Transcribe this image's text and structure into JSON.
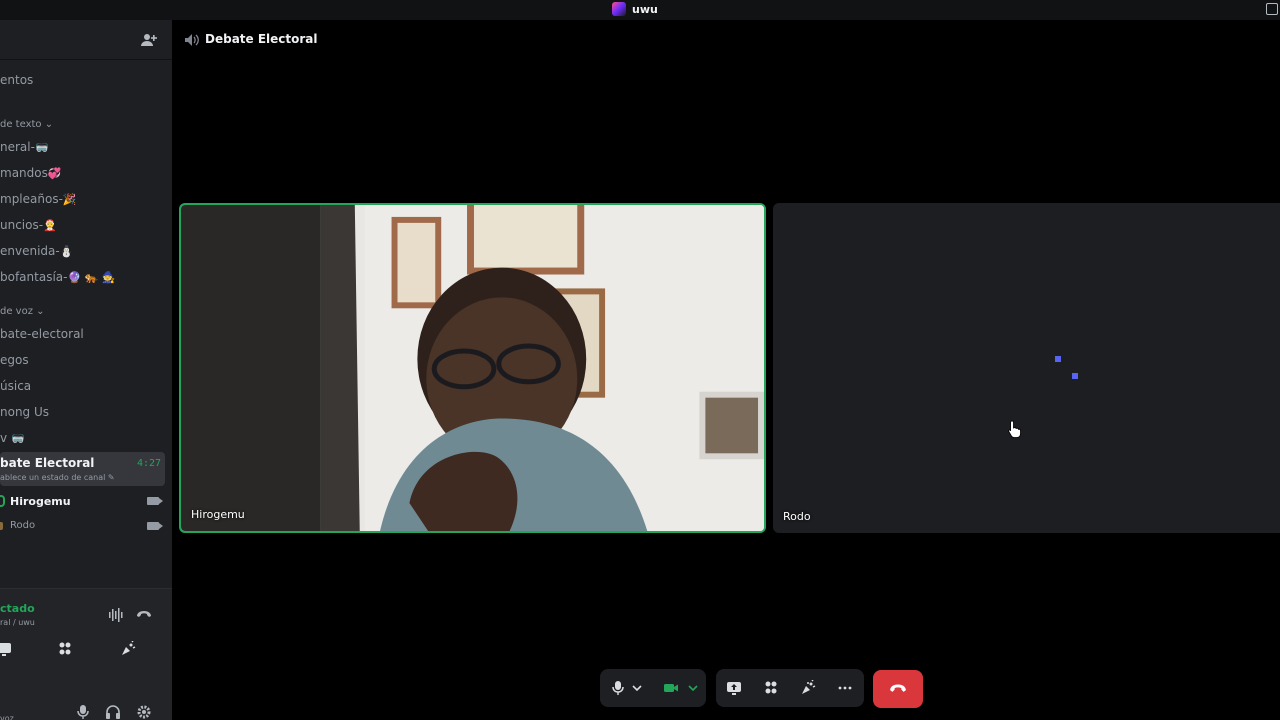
{
  "window": {
    "title": "uwu"
  },
  "sidebar": {
    "events_label": "entos",
    "text_category": "de texto ⌄",
    "text_channels": [
      {
        "label": "neral-",
        "emoji": "🥽"
      },
      {
        "label": "mandos",
        "emoji": "💞"
      },
      {
        "label": "mpleaños-",
        "emoji": "🎉"
      },
      {
        "label": "uncios-",
        "emoji": "🤶"
      },
      {
        "label": "envenida-",
        "emoji": "⛄"
      },
      {
        "label": "bofantasía-",
        "emoji": "🔮 🐅 🧙"
      }
    ],
    "voice_category": "de voz ⌄",
    "voice_channels": [
      {
        "label": "bate-electoral"
      },
      {
        "label": "egos"
      },
      {
        "label": "úsica"
      },
      {
        "label": "nong Us"
      },
      {
        "label": "v",
        "emoji": "🥽"
      }
    ],
    "active_channel": {
      "name": "bate Electoral",
      "time": "4:27",
      "status_prompt": "ablece un estado de canal ✎"
    },
    "voice_users": [
      {
        "name": "Hirogemu"
      },
      {
        "name": "Rodo"
      }
    ]
  },
  "voice_panel": {
    "status": "ctado",
    "sub": "ral / uwu"
  },
  "user_panel": {
    "status_text": "voz"
  },
  "main": {
    "channel_name": "Debate Electoral",
    "tiles": [
      {
        "name": "Hirogemu",
        "speaking": true
      },
      {
        "name": "Rodo",
        "speaking": false
      }
    ]
  },
  "colors": {
    "accent": "#5865f2",
    "speaking": "#23a55a",
    "hangup": "#da373c",
    "background": "#000000",
    "sidebar": "#1e1f22"
  },
  "icons": [
    "add-friend-icon",
    "speaker-icon",
    "mic-icon",
    "camera-icon",
    "screen-share-icon",
    "activities-icon",
    "soundboard-icon",
    "more-icon",
    "hangup-icon",
    "headphones-icon",
    "gear-icon",
    "noise-suppression-icon",
    "disconnect-icon"
  ]
}
